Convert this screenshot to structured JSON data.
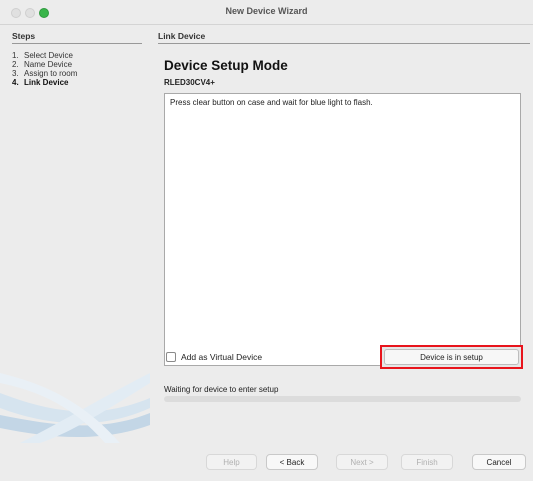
{
  "window": {
    "title": "New Device Wizard"
  },
  "steps": {
    "heading": "Steps",
    "items": [
      {
        "num": "1.",
        "label": "Select Device",
        "current": false
      },
      {
        "num": "2.",
        "label": "Name Device",
        "current": false
      },
      {
        "num": "3.",
        "label": "Assign to room",
        "current": false
      },
      {
        "num": "4.",
        "label": "Link Device",
        "current": true
      }
    ]
  },
  "main": {
    "section_title": "Link Device",
    "mode_title": "Device Setup Mode",
    "model": "RLED30CV4+",
    "instructions": "Press clear button on case and wait for blue light to flash.",
    "virtual_checkbox_label": "Add as Virtual Device",
    "virtual_checked": false,
    "setup_button_label": "Device is in setup",
    "status_text": "Waiting for device to enter setup",
    "progress": 0
  },
  "footer": {
    "help_label": "Help",
    "back_label": "< Back",
    "next_label": "Next >",
    "finish_label": "Finish",
    "cancel_label": "Cancel"
  },
  "colors": {
    "highlight_box": "#e8141c",
    "traffic_green": "#39b54a",
    "window_bg": "#ececec"
  }
}
